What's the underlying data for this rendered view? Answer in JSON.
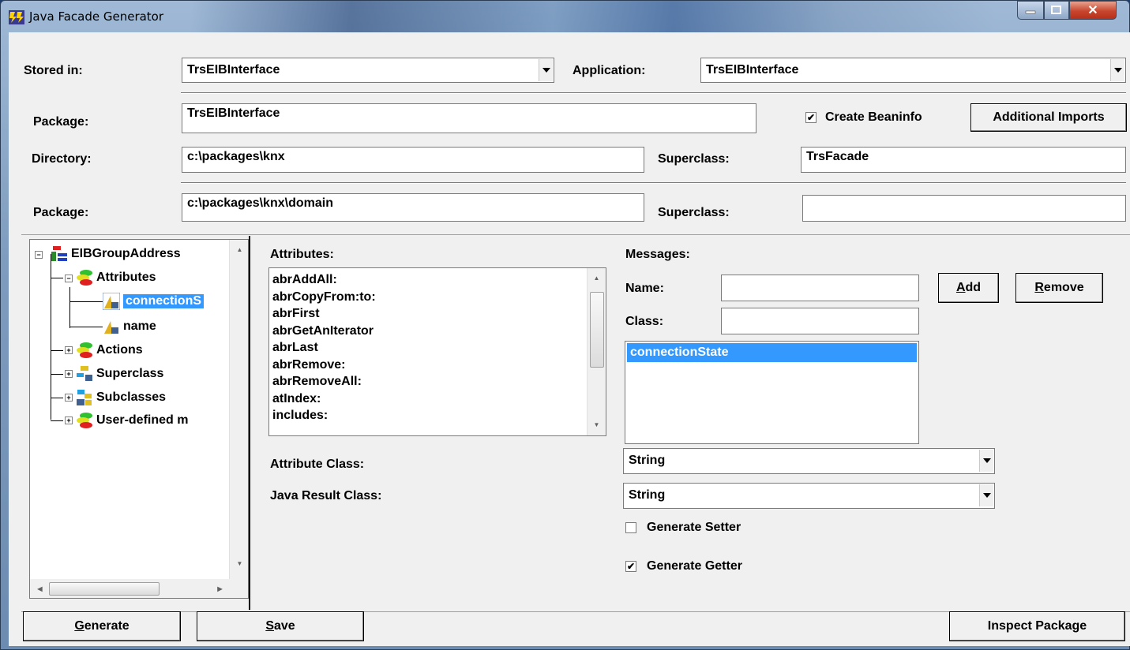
{
  "window": {
    "title": "Java Facade Generator"
  },
  "form": {
    "stored_in_label": "Stored in:",
    "stored_in_value": "TrsEIBInterface",
    "application_label": "Application:",
    "application_value": "TrsEIBInterface",
    "package_label": "Package:",
    "package_value": "TrsEIBInterface",
    "create_beaninfo_label": "Create Beaninfo",
    "create_beaninfo_checked": true,
    "additional_imports_label": "Additional Imports",
    "directory_label": "Directory:",
    "directory_value": "c:\\packages\\knx",
    "superclass_label": "Superclass:",
    "superclass_value": "TrsFacade",
    "package2_label": "Package:",
    "package2_value": "c:\\packages\\knx\\domain",
    "superclass2_label": "Superclass:",
    "superclass2_value": ""
  },
  "tree": {
    "root": "EIBGroupAddress",
    "attributes": "Attributes",
    "attr_items": [
      "connectionS",
      "name"
    ],
    "selected_attr": "connectionS",
    "actions": "Actions",
    "superclass": "Superclass",
    "subclasses": "Subclasses",
    "user_defined": "User-defined m"
  },
  "attributes_panel": {
    "label": "Attributes:",
    "items": [
      "abrAddAll:",
      "abrCopyFrom:to:",
      "abrFirst",
      "abrGetAnIterator",
      "abrLast",
      "abrRemove:",
      "abrRemoveAll:",
      "atIndex:",
      "includes:"
    ],
    "attribute_class_label": "Attribute Class:",
    "attribute_class_value": "String",
    "java_result_class_label": "Java Result Class:",
    "java_result_class_value": "String"
  },
  "messages_panel": {
    "label": "Messages:",
    "name_label": "Name:",
    "name_value": "",
    "class_label": "Class:",
    "class_value": "",
    "add_button": "Add",
    "add_accel": "A",
    "add_rest": "dd",
    "remove_button": "Remove",
    "remove_accel": "R",
    "remove_rest": "emove",
    "items": [
      "connectionState"
    ],
    "selected_index": 0,
    "generate_setter_label": "Generate Setter",
    "generate_setter_checked": false,
    "generate_getter_label": "Generate Getter",
    "generate_getter_checked": true
  },
  "buttons": {
    "generate_accel": "G",
    "generate_rest": "enerate",
    "save_accel": "S",
    "save_rest": "ave",
    "inspect_package": "Inspect Package"
  }
}
